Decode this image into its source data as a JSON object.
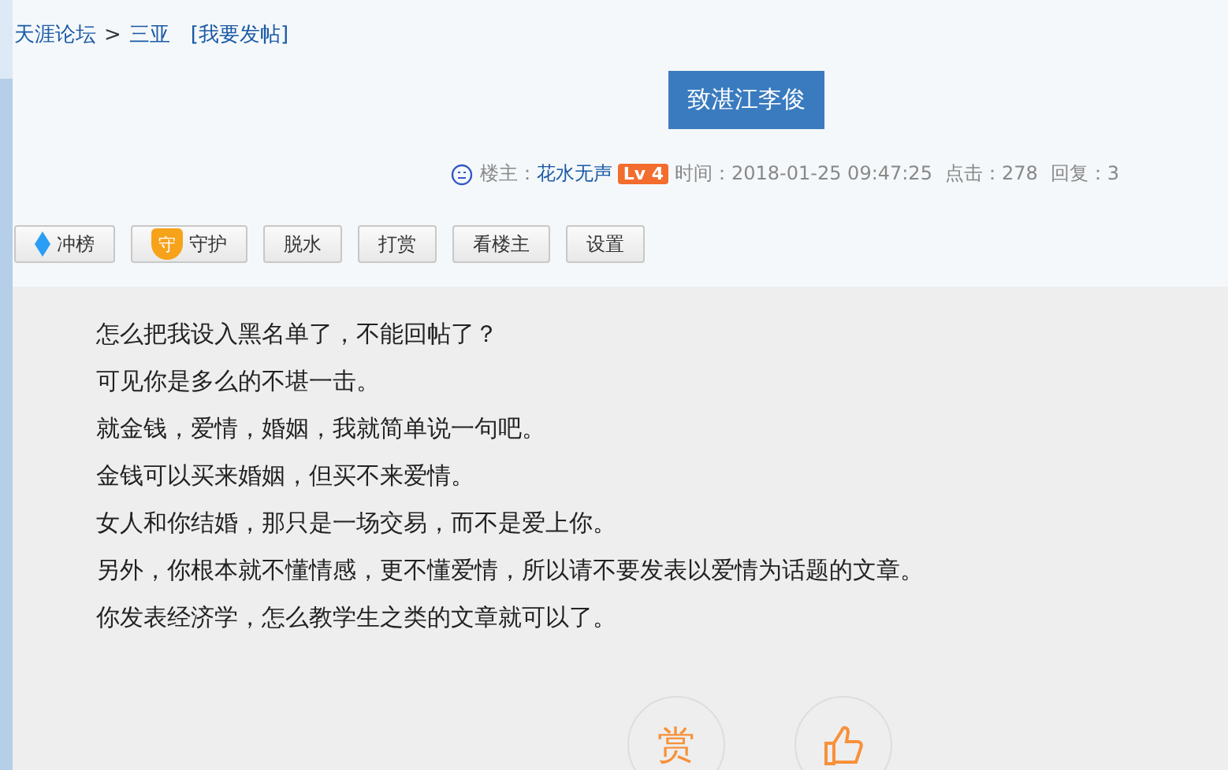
{
  "breadcrumb": {
    "items": [
      "天涯论坛",
      "三亚"
    ],
    "separator": ">",
    "action": "[我要发帖]"
  },
  "post": {
    "title": "致湛江李俊",
    "meta": {
      "author_label": "楼主：",
      "author": "花水无声",
      "level": "Lv 4",
      "time": "时间：2018-01-25 09:47:25",
      "clicks": "点击：278",
      "replies": "回复：3"
    },
    "toolbar": [
      {
        "kind": "diamond",
        "label": "冲榜"
      },
      {
        "kind": "shield",
        "label": "守护",
        "icon_text": "守"
      },
      {
        "kind": "plain",
        "label": "脱水"
      },
      {
        "kind": "plain",
        "label": "打赏"
      },
      {
        "kind": "plain",
        "label": "看楼主"
      },
      {
        "kind": "plain",
        "label": "设置"
      }
    ],
    "lines": [
      "怎么把我设入黑名单了，不能回帖了？",
      "可见你是多么的不堪一击。",
      "就金钱，爱情，婚姻，我就简单说一句吧。",
      "金钱可以买来婚姻，但买不来爱情。",
      "女人和你结婚，那只是一场交易，而不是爱上你。",
      "另外，你根本就不懂情感，更不懂爱情，所以请不要发表以爱情为话题的文章。",
      "你发表经济学，怎么教学生之类的文章就可以了。"
    ],
    "actions": [
      {
        "kind": "text",
        "label": "赏"
      },
      {
        "kind": "like"
      }
    ]
  }
}
